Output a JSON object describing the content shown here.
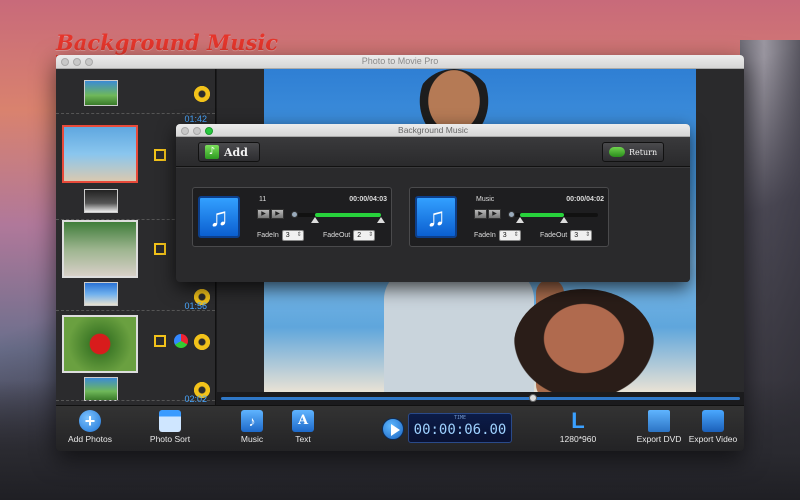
{
  "headline": "Background Music",
  "main_window": {
    "title": "Photo to Movie Pro"
  },
  "sidebar": {
    "times": [
      "01:42",
      "01:56",
      "02:02"
    ]
  },
  "toolbar": {
    "add_photos": "Add Photos",
    "photo_sort": "Photo Sort",
    "music": "Music",
    "text": "Text",
    "time_label": "TIME",
    "time": "00:00:06.00",
    "resolution": "1280*960",
    "export_dvd": "Export DVD",
    "export_video": "Export Video"
  },
  "dialog": {
    "title": "Background Music",
    "add_label": "Add",
    "return_label": "Return",
    "tracks": [
      {
        "name": "11",
        "duration": "00:00/04:03",
        "fadein_label": "FadeIn",
        "fadein": "3",
        "fadeout_label": "FadeOut",
        "fadeout": "2"
      },
      {
        "name": "Music",
        "duration": "00:00/04:02",
        "fadein_label": "FadeIn",
        "fadein": "3",
        "fadeout_label": "FadeOut",
        "fadeout": "3"
      }
    ]
  },
  "colors": {
    "accent": "#2f78c8",
    "headline": "#e6362c",
    "selection": "#e84a3a",
    "gear": "#f2c21a",
    "slider_fill": "#27d23b"
  }
}
